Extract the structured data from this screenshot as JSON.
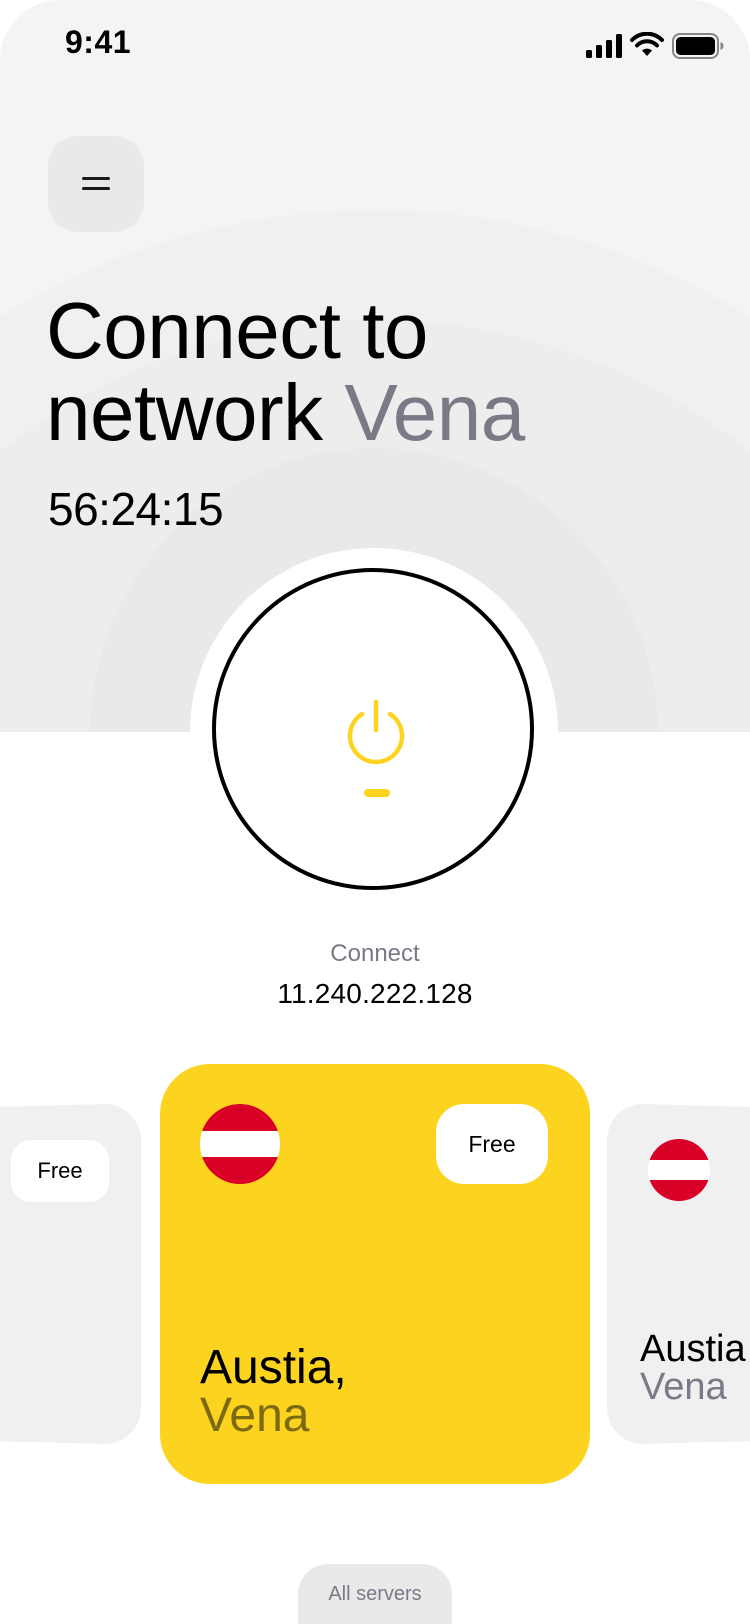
{
  "status_bar": {
    "time": "9:41",
    "signal_icon": "cellular-signal-icon",
    "wifi_icon": "wifi-icon",
    "battery_icon": "battery-full-icon"
  },
  "menu": {
    "icon": "hamburger-menu-icon"
  },
  "headline": {
    "line1": "Connect to",
    "line2_prefix": "network ",
    "line2_accent": "Vena"
  },
  "timer": "56:24:15",
  "power": {
    "icon": "power-icon",
    "status_label": "Connect",
    "ip_address": "11.240.222.128"
  },
  "servers": [
    {
      "badge": "Free",
      "country": "",
      "city": ""
    },
    {
      "badge": "Free",
      "country": "Austia,",
      "city": "Vena",
      "flag": "austria-flag"
    },
    {
      "badge": "",
      "country": "Austia",
      "city": "Vena",
      "flag": "austria-flag"
    }
  ],
  "all_servers_label": "All servers",
  "colors": {
    "accent_yellow": "#fcd41f",
    "muted_text": "#7b7986",
    "background_gray": "#f4f4f5",
    "flag_red": "#d90028"
  }
}
